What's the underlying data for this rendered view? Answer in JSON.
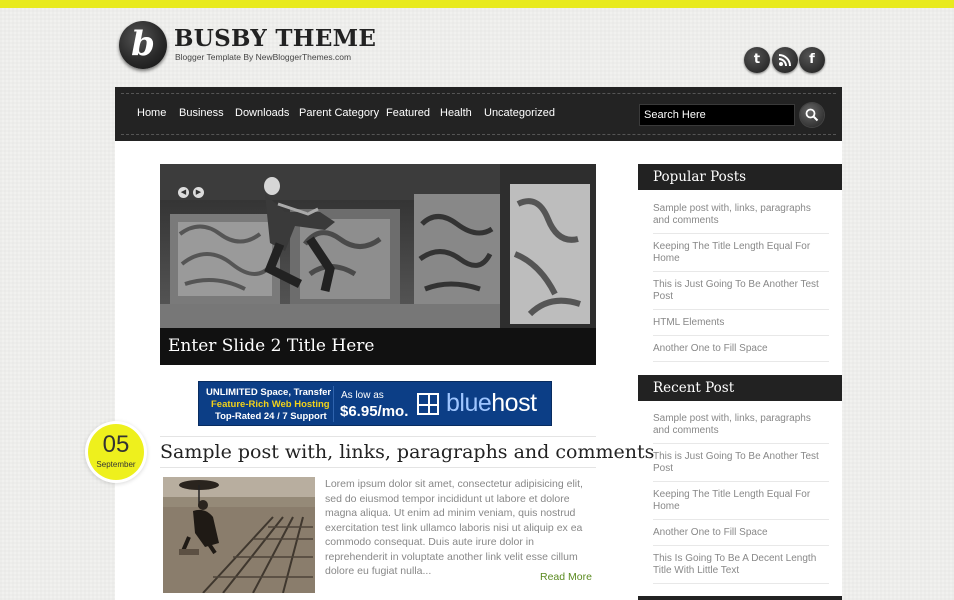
{
  "header": {
    "logo_letter": "b",
    "site_title": "BUSBY THEME",
    "tagline": "Blogger Template By NewBloggerThemes.com",
    "social_icons": [
      "twitter-icon",
      "rss-icon",
      "facebook-icon"
    ],
    "social_glyphs": [
      "t",
      "",
      "f"
    ]
  },
  "nav": {
    "items": [
      "Home",
      "Business",
      "Downloads",
      "Parent Category",
      "Featured",
      "Health",
      "Uncategorized"
    ],
    "search_value": "Search Here"
  },
  "slider": {
    "caption": "Enter Slide 2 Title Here",
    "prev": "◀",
    "next": "▶"
  },
  "ad": {
    "line1": "UNLIMITED Space, Transfer",
    "line2": "Feature-Rich Web Hosting",
    "line3": "Top-Rated 24 / 7 Support",
    "price_prefix": "As low as",
    "price": "$6.95/mo.",
    "brand_a": "blue",
    "brand_b": "host"
  },
  "post": {
    "day": "05",
    "month": "September",
    "title": "Sample post with, links, paragraphs and comments",
    "excerpt": "Lorem ipsum dolor sit amet, consectetur adipisicing elit, sed do eiusmod tempor incididunt ut labore et dolore magna aliqua. Ut enim ad minim veniam, quis nostrud exercitation test link ullamco laboris nisi ut aliquip ex ea commodo consequat. Duis aute irure dolor in reprehenderit in voluptate another link velit esse cillum dolore eu fugiat nulla...",
    "read_more": "Read More"
  },
  "sidebar": {
    "popular_title": "Popular Posts",
    "popular": [
      "Sample post with, links, paragraphs and comments",
      "Keeping The Title Length Equal For Home",
      "This is Just Going To Be Another Test Post",
      "HTML Elements",
      "Another One to Fill Space"
    ],
    "recent_title": "Recent Post",
    "recent": [
      "Sample post with, links, paragraphs and comments",
      "This is Just Going To Be Another Test Post",
      "Keeping The Title Length Equal For Home",
      "Another One to Fill Space",
      "This Is Going To Be A Decent Length Title With Little Text"
    ]
  },
  "colors": {
    "accent_yellow": "#e8ea1e",
    "nav_bg": "#232323",
    "link_green": "#5a8a1f"
  }
}
